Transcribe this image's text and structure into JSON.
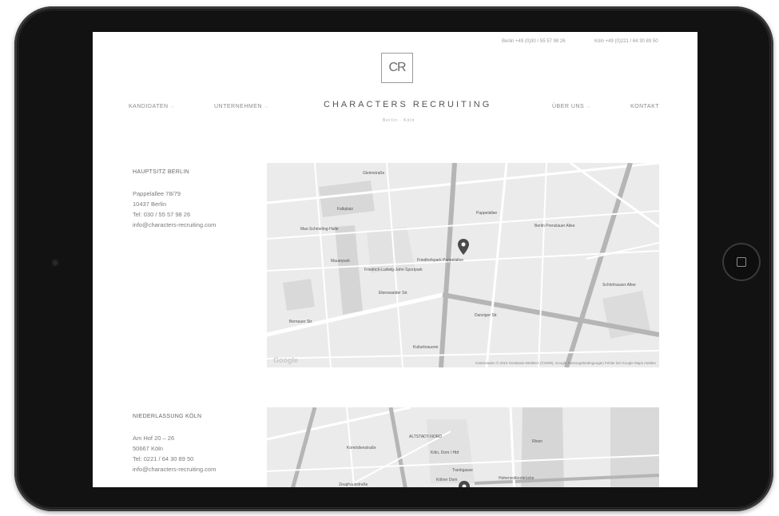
{
  "header": {
    "berlin_contact": "Berlin +49 (0)30 / 55 57 98 26",
    "koeln_contact": "Köln +49 (0)221 / 64 30 89 50",
    "logo": "CR",
    "brand": "CHARACTERS RECRUITING",
    "cities": "Berlin · Köln"
  },
  "nav": {
    "kandidaten": "KANDIDATEN",
    "unternehmen": "UNTERNEHMEN",
    "ueber_uns": "ÜBER UNS",
    "kontakt": "KONTAKT"
  },
  "offices": [
    {
      "title": "HAUPTSITZ BERLIN",
      "street": "Pappelallee 78/79",
      "city": "10437 Berlin",
      "phone": "Tel: 030 / 55 57 98 26",
      "email": "info@characters-recruiting.com"
    },
    {
      "title": "NIEDERLASSUNG KÖLN",
      "street": "Am Hof 20 – 26",
      "city": "50667 Köln",
      "phone": "Tel: 0221 / 64 30 89 50",
      "email": "info@characters-recruiting.com"
    }
  ],
  "map_berlin": {
    "labels": {
      "gleimstrasse": "Gleimstraße",
      "falkplatz": "Falkplatz",
      "schmeling": "Max-Schmeling-Halle",
      "mauerpark": "Mauerpark",
      "jahn": "Friedrich-Ludwig-Jahn-Sportpark",
      "friedhofspark": "Friedhofspark Pappelallee",
      "prenzlauer": "Berlin Prenzlauer Allee",
      "eberswalder": "Eberswalder Str.",
      "bernauer": "Bernauer Str.",
      "kulturbrauerei": "Kulturbrauerei",
      "danziger": "Danziger Str.",
      "schoenhauser": "Schönhauser Allee",
      "pappelallee": "Pappelallee"
    },
    "attribution": "Kartendaten © 2015 GeoBasis-DE/BKG (©2009), Google   Nutzungsbedingungen   Fehler bei Google Maps melden",
    "google": "Google"
  },
  "map_koeln": {
    "labels": {
      "altstadt": "ALTSTADT-NORD",
      "koeln_dom": "Köln, Dom / Hbf",
      "koelner_dom": "Kölner Dom",
      "hohenzollern": "Hohenzollernbrücke",
      "zeughaus": "Zeughausstraße",
      "komoedien": "Komödienstraße",
      "trankgasse": "Trankgasse",
      "rhein": "Rhein"
    }
  },
  "colors": {
    "bezel": "#121212",
    "map_bg": "#ebebeb",
    "road": "#ffffff",
    "major_road": "#b5b5b5",
    "pin": "#4a4a4a"
  }
}
